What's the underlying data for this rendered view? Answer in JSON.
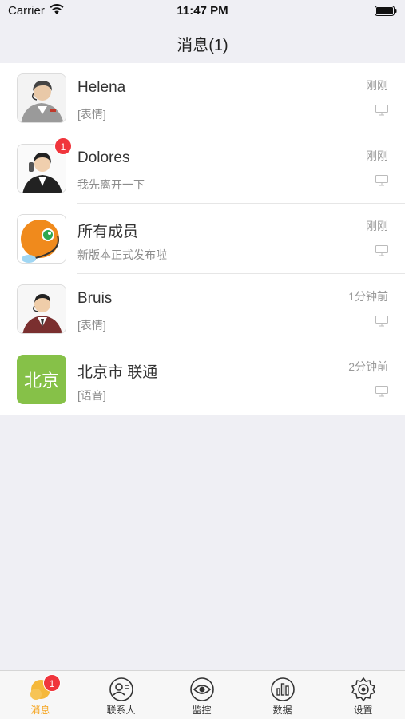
{
  "status_bar": {
    "carrier": "Carrier",
    "time": "11:47 PM"
  },
  "nav": {
    "title": "消息(1)"
  },
  "messages": [
    {
      "name": "Helena",
      "preview": "[表情]",
      "time": "刚刚",
      "avatar": "agent-female-headset-gray"
    },
    {
      "name": "Dolores",
      "preview": "我先离开一下",
      "time": "刚刚",
      "avatar": "agent-female-phone",
      "badge": "1"
    },
    {
      "name": "所有成员",
      "preview": "新版本正式发布啦",
      "time": "刚刚",
      "avatar": "orange-mascot-headset"
    },
    {
      "name": "Bruis",
      "preview": "[表情]",
      "time": "1分钟前",
      "avatar": "agent-male-headset"
    },
    {
      "name": "北京市 联通",
      "preview": "[语音]",
      "time": "2分钟前",
      "avatar_text": "北京",
      "avatar_color": "#86c148"
    }
  ],
  "tabs": [
    {
      "label": "消息",
      "icon": "chat-bubble-icon",
      "badge": "1",
      "active": true
    },
    {
      "label": "联系人",
      "icon": "contacts-icon"
    },
    {
      "label": "监控",
      "icon": "eye-icon"
    },
    {
      "label": "数据",
      "icon": "chart-icon"
    },
    {
      "label": "设置",
      "icon": "gear-icon"
    }
  ],
  "colors": {
    "accent": "#f5a623",
    "badge": "#f0353c",
    "avatar_green": "#86c148"
  }
}
